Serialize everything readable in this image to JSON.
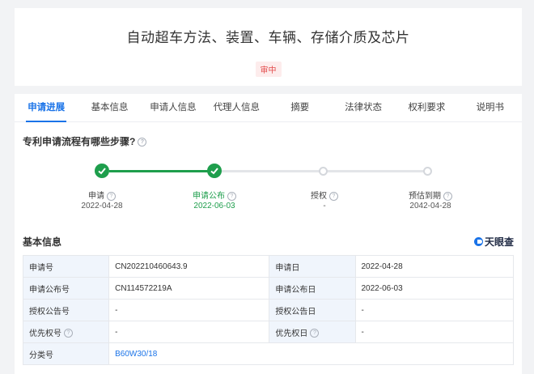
{
  "title_card": {
    "title": "自动超车方法、装置、车辆、存储介质及芯片",
    "status": "审中"
  },
  "tabs": [
    {
      "label": "申请进展",
      "active": true
    },
    {
      "label": "基本信息",
      "active": false
    },
    {
      "label": "申请人信息",
      "active": false
    },
    {
      "label": "代理人信息",
      "active": false
    },
    {
      "label": "摘要",
      "active": false
    },
    {
      "label": "法律状态",
      "active": false
    },
    {
      "label": "权利要求",
      "active": false
    },
    {
      "label": "说明书",
      "active": false
    }
  ],
  "progress": {
    "question": "专利申请流程有哪些步骤?",
    "steps": [
      {
        "label": "申请",
        "date": "2022-04-28",
        "state": "done"
      },
      {
        "label": "申请公布",
        "date": "2022-06-03",
        "state": "done"
      },
      {
        "label": "授权",
        "date": "-",
        "state": "pending"
      },
      {
        "label": "预估到期",
        "date": "2042-04-28",
        "state": "pending"
      }
    ]
  },
  "basic_info": {
    "heading": "基本信息",
    "brand": "天眼查",
    "rows": [
      {
        "k1": "申请号",
        "v1": "CN202210460643.9",
        "k2": "申请日",
        "v2": "2022-04-28"
      },
      {
        "k1": "申请公布号",
        "v1": "CN114572219A",
        "k2": "申请公布日",
        "v2": "2022-06-03"
      },
      {
        "k1": "授权公告号",
        "v1": "-",
        "k2": "授权公告日",
        "v2": "-"
      },
      {
        "k1": "优先权号",
        "v1": "-",
        "k2": "优先权日",
        "v2": "-"
      },
      {
        "k1": "分类号",
        "v1": "B60W30/18"
      }
    ]
  },
  "colors": {
    "accent": "#1a73e8",
    "done": "#1e9e4c",
    "status_text": "#e34d4d"
  }
}
